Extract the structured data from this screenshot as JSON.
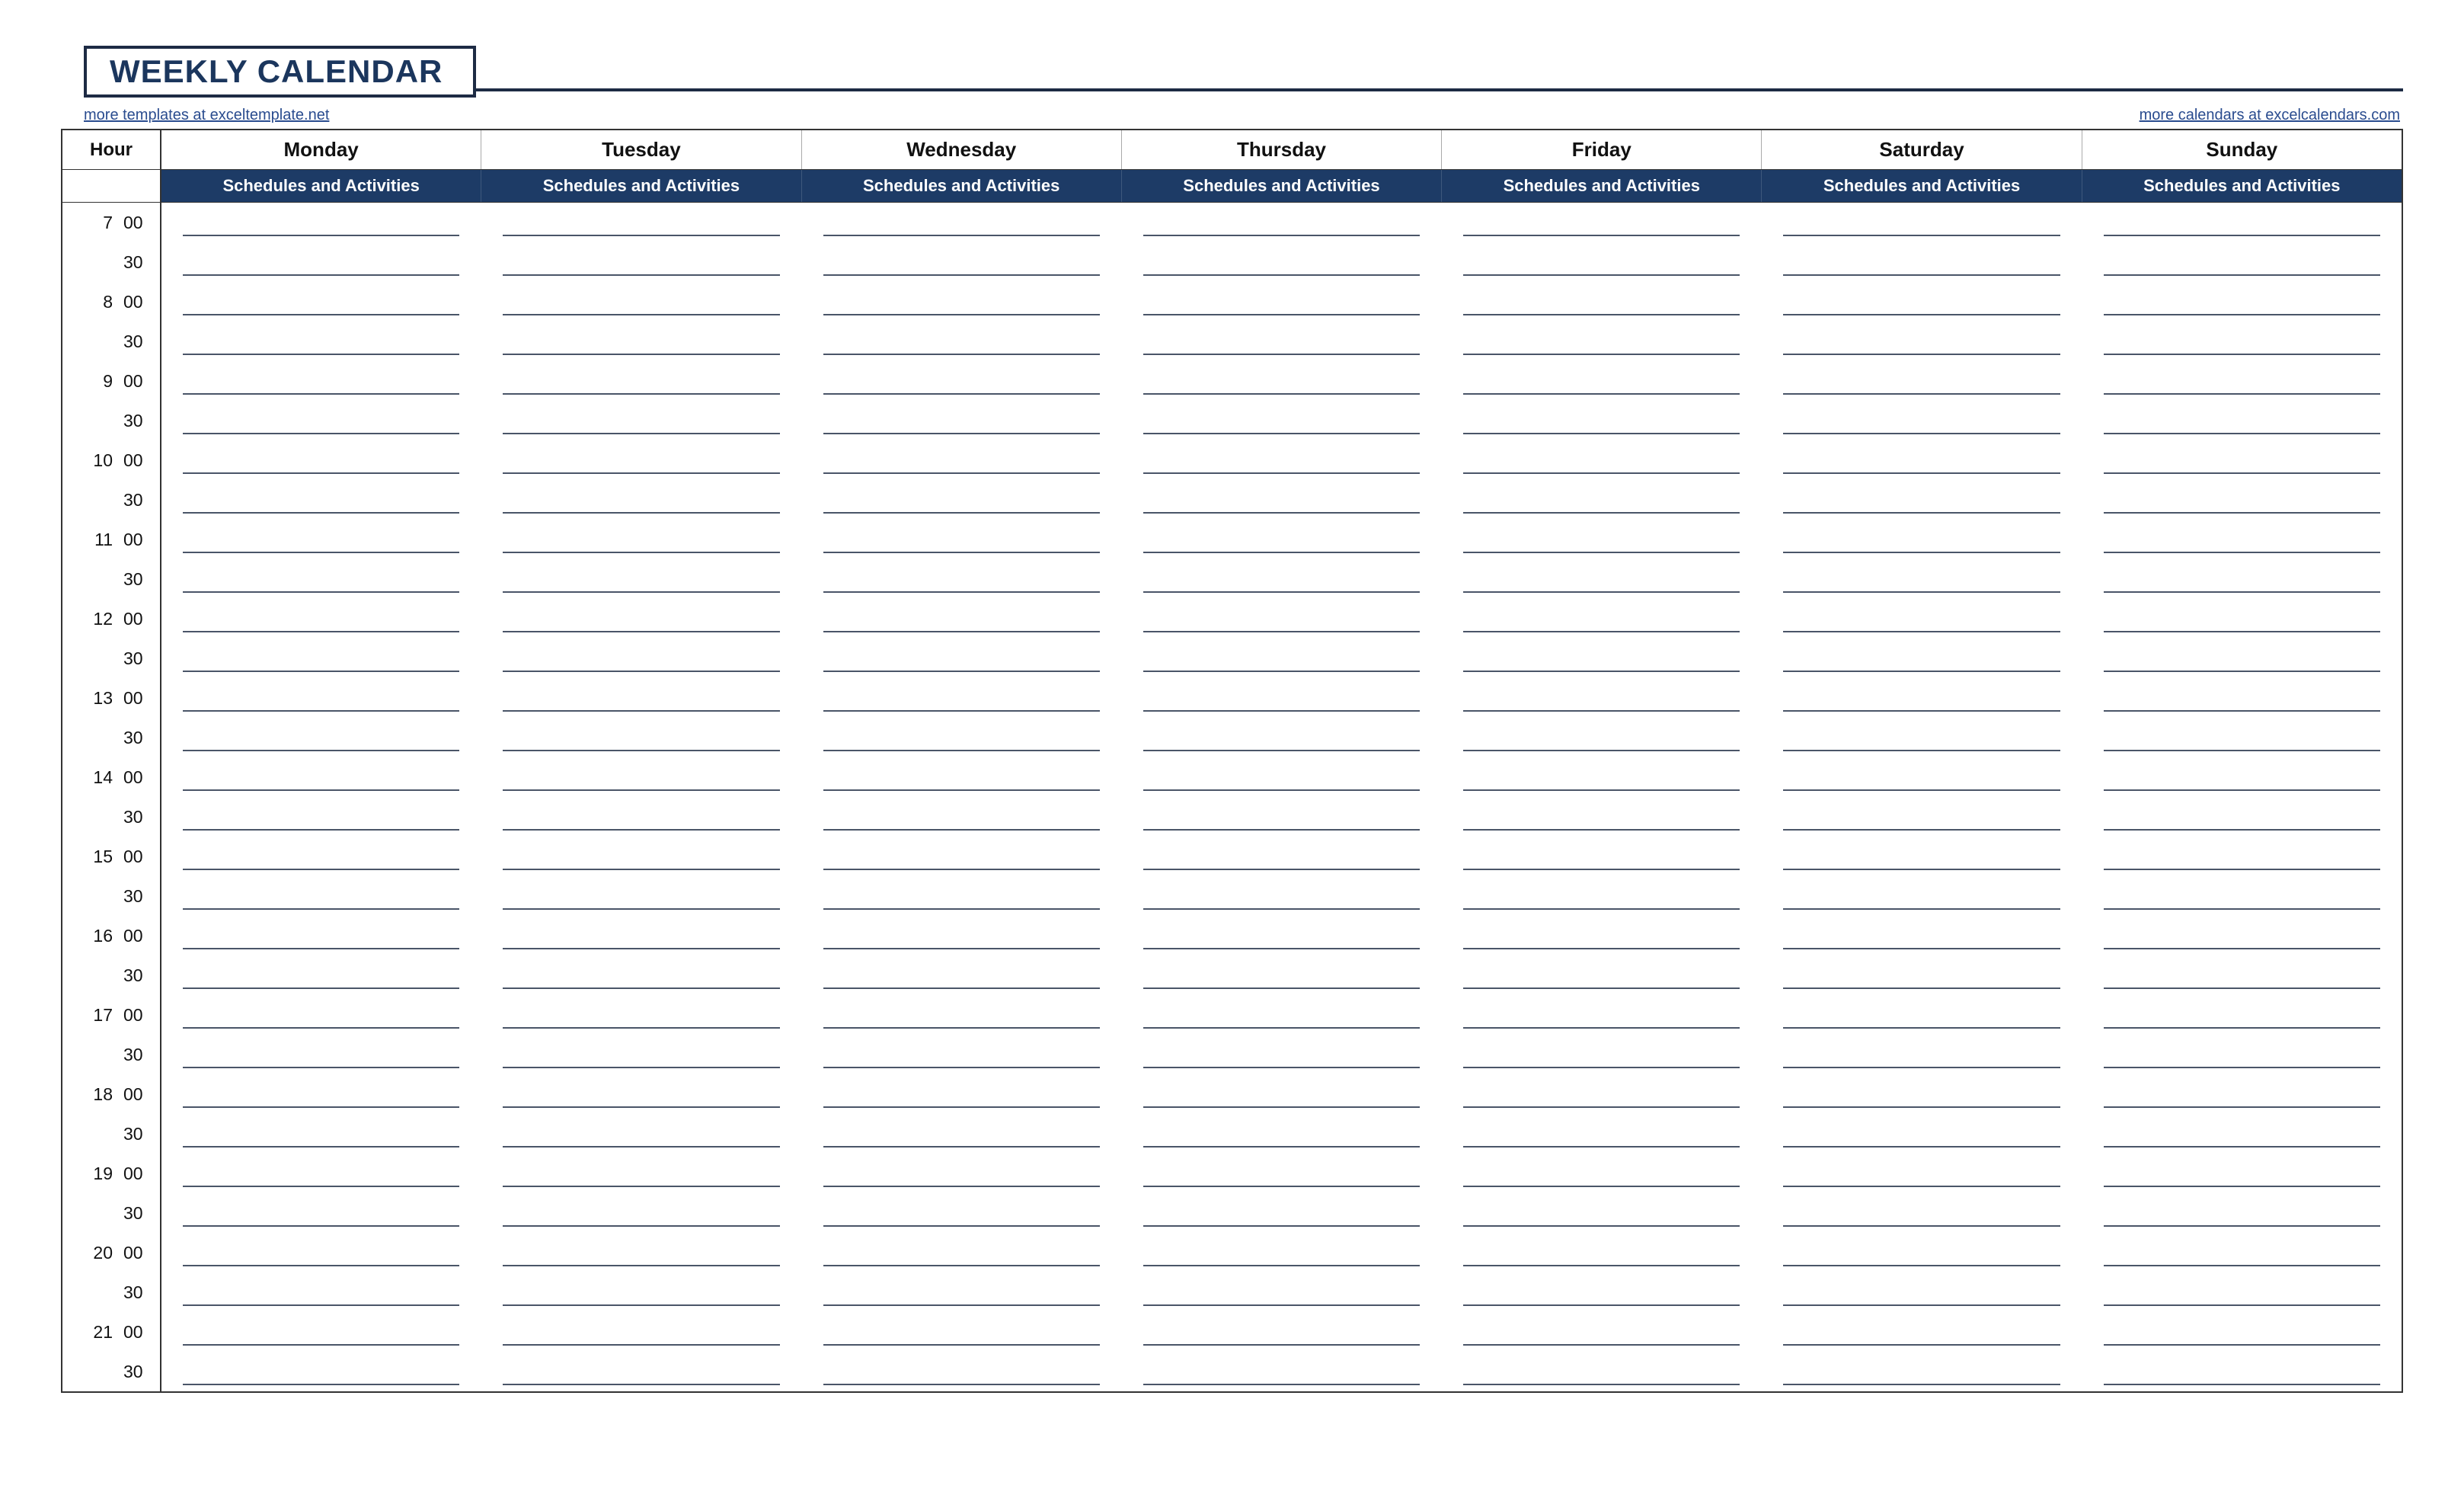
{
  "title": "WEEKLY CALENDAR",
  "links": {
    "left": "more templates at exceltemplate.net",
    "right": "more calendars at excelcalendars.com"
  },
  "columns": {
    "hour_label": "Hour",
    "activities_label": "Schedules and Activities",
    "days": [
      "Monday",
      "Tuesday",
      "Wednesday",
      "Thursday",
      "Friday",
      "Saturday",
      "Sunday"
    ]
  },
  "time_slots": [
    {
      "hour": "7",
      "minute": "00"
    },
    {
      "hour": "",
      "minute": "30"
    },
    {
      "hour": "8",
      "minute": "00"
    },
    {
      "hour": "",
      "minute": "30"
    },
    {
      "hour": "9",
      "minute": "00"
    },
    {
      "hour": "",
      "minute": "30"
    },
    {
      "hour": "10",
      "minute": "00"
    },
    {
      "hour": "",
      "minute": "30"
    },
    {
      "hour": "11",
      "minute": "00"
    },
    {
      "hour": "",
      "minute": "30"
    },
    {
      "hour": "12",
      "minute": "00"
    },
    {
      "hour": "",
      "minute": "30"
    },
    {
      "hour": "13",
      "minute": "00"
    },
    {
      "hour": "",
      "minute": "30"
    },
    {
      "hour": "14",
      "minute": "00"
    },
    {
      "hour": "",
      "minute": "30"
    },
    {
      "hour": "15",
      "minute": "00"
    },
    {
      "hour": "",
      "minute": "30"
    },
    {
      "hour": "16",
      "minute": "00"
    },
    {
      "hour": "",
      "minute": "30"
    },
    {
      "hour": "17",
      "minute": "00"
    },
    {
      "hour": "",
      "minute": "30"
    },
    {
      "hour": "18",
      "minute": "00"
    },
    {
      "hour": "",
      "minute": "30"
    },
    {
      "hour": "19",
      "minute": "00"
    },
    {
      "hour": "",
      "minute": "30"
    },
    {
      "hour": "20",
      "minute": "00"
    },
    {
      "hour": "",
      "minute": "30"
    },
    {
      "hour": "21",
      "minute": "00"
    },
    {
      "hour": "",
      "minute": "30"
    }
  ]
}
